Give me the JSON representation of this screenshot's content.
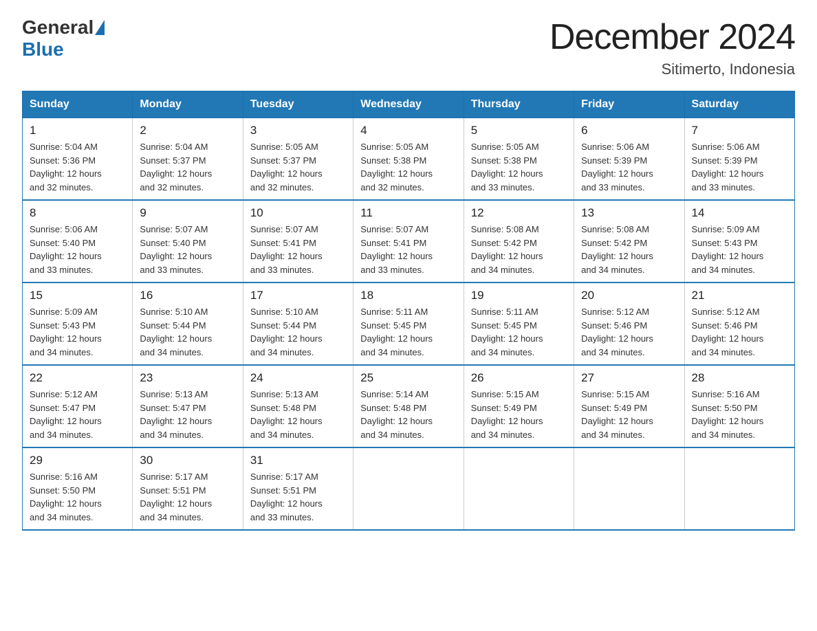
{
  "logo": {
    "general": "General",
    "blue": "Blue"
  },
  "title": "December 2024",
  "subtitle": "Sitimerto, Indonesia",
  "days_header": [
    "Sunday",
    "Monday",
    "Tuesday",
    "Wednesday",
    "Thursday",
    "Friday",
    "Saturday"
  ],
  "weeks": [
    [
      {
        "day": "1",
        "sunrise": "5:04 AM",
        "sunset": "5:36 PM",
        "daylight": "12 hours and 32 minutes."
      },
      {
        "day": "2",
        "sunrise": "5:04 AM",
        "sunset": "5:37 PM",
        "daylight": "12 hours and 32 minutes."
      },
      {
        "day": "3",
        "sunrise": "5:05 AM",
        "sunset": "5:37 PM",
        "daylight": "12 hours and 32 minutes."
      },
      {
        "day": "4",
        "sunrise": "5:05 AM",
        "sunset": "5:38 PM",
        "daylight": "12 hours and 32 minutes."
      },
      {
        "day": "5",
        "sunrise": "5:05 AM",
        "sunset": "5:38 PM",
        "daylight": "12 hours and 33 minutes."
      },
      {
        "day": "6",
        "sunrise": "5:06 AM",
        "sunset": "5:39 PM",
        "daylight": "12 hours and 33 minutes."
      },
      {
        "day": "7",
        "sunrise": "5:06 AM",
        "sunset": "5:39 PM",
        "daylight": "12 hours and 33 minutes."
      }
    ],
    [
      {
        "day": "8",
        "sunrise": "5:06 AM",
        "sunset": "5:40 PM",
        "daylight": "12 hours and 33 minutes."
      },
      {
        "day": "9",
        "sunrise": "5:07 AM",
        "sunset": "5:40 PM",
        "daylight": "12 hours and 33 minutes."
      },
      {
        "day": "10",
        "sunrise": "5:07 AM",
        "sunset": "5:41 PM",
        "daylight": "12 hours and 33 minutes."
      },
      {
        "day": "11",
        "sunrise": "5:07 AM",
        "sunset": "5:41 PM",
        "daylight": "12 hours and 33 minutes."
      },
      {
        "day": "12",
        "sunrise": "5:08 AM",
        "sunset": "5:42 PM",
        "daylight": "12 hours and 34 minutes."
      },
      {
        "day": "13",
        "sunrise": "5:08 AM",
        "sunset": "5:42 PM",
        "daylight": "12 hours and 34 minutes."
      },
      {
        "day": "14",
        "sunrise": "5:09 AM",
        "sunset": "5:43 PM",
        "daylight": "12 hours and 34 minutes."
      }
    ],
    [
      {
        "day": "15",
        "sunrise": "5:09 AM",
        "sunset": "5:43 PM",
        "daylight": "12 hours and 34 minutes."
      },
      {
        "day": "16",
        "sunrise": "5:10 AM",
        "sunset": "5:44 PM",
        "daylight": "12 hours and 34 minutes."
      },
      {
        "day": "17",
        "sunrise": "5:10 AM",
        "sunset": "5:44 PM",
        "daylight": "12 hours and 34 minutes."
      },
      {
        "day": "18",
        "sunrise": "5:11 AM",
        "sunset": "5:45 PM",
        "daylight": "12 hours and 34 minutes."
      },
      {
        "day": "19",
        "sunrise": "5:11 AM",
        "sunset": "5:45 PM",
        "daylight": "12 hours and 34 minutes."
      },
      {
        "day": "20",
        "sunrise": "5:12 AM",
        "sunset": "5:46 PM",
        "daylight": "12 hours and 34 minutes."
      },
      {
        "day": "21",
        "sunrise": "5:12 AM",
        "sunset": "5:46 PM",
        "daylight": "12 hours and 34 minutes."
      }
    ],
    [
      {
        "day": "22",
        "sunrise": "5:12 AM",
        "sunset": "5:47 PM",
        "daylight": "12 hours and 34 minutes."
      },
      {
        "day": "23",
        "sunrise": "5:13 AM",
        "sunset": "5:47 PM",
        "daylight": "12 hours and 34 minutes."
      },
      {
        "day": "24",
        "sunrise": "5:13 AM",
        "sunset": "5:48 PM",
        "daylight": "12 hours and 34 minutes."
      },
      {
        "day": "25",
        "sunrise": "5:14 AM",
        "sunset": "5:48 PM",
        "daylight": "12 hours and 34 minutes."
      },
      {
        "day": "26",
        "sunrise": "5:15 AM",
        "sunset": "5:49 PM",
        "daylight": "12 hours and 34 minutes."
      },
      {
        "day": "27",
        "sunrise": "5:15 AM",
        "sunset": "5:49 PM",
        "daylight": "12 hours and 34 minutes."
      },
      {
        "day": "28",
        "sunrise": "5:16 AM",
        "sunset": "5:50 PM",
        "daylight": "12 hours and 34 minutes."
      }
    ],
    [
      {
        "day": "29",
        "sunrise": "5:16 AM",
        "sunset": "5:50 PM",
        "daylight": "12 hours and 34 minutes."
      },
      {
        "day": "30",
        "sunrise": "5:17 AM",
        "sunset": "5:51 PM",
        "daylight": "12 hours and 34 minutes."
      },
      {
        "day": "31",
        "sunrise": "5:17 AM",
        "sunset": "5:51 PM",
        "daylight": "12 hours and 33 minutes."
      },
      {
        "day": "",
        "sunrise": "",
        "sunset": "",
        "daylight": ""
      },
      {
        "day": "",
        "sunrise": "",
        "sunset": "",
        "daylight": ""
      },
      {
        "day": "",
        "sunrise": "",
        "sunset": "",
        "daylight": ""
      },
      {
        "day": "",
        "sunrise": "",
        "sunset": "",
        "daylight": ""
      }
    ]
  ]
}
